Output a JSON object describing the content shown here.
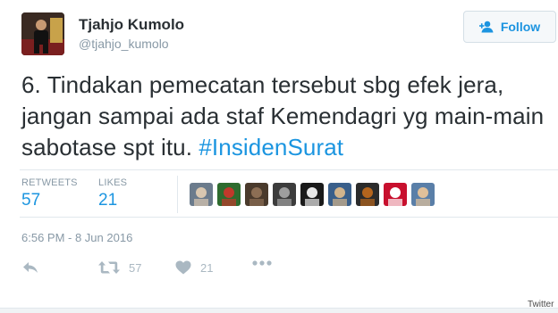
{
  "user": {
    "display_name": "Tjahjo Kumolo",
    "handle": "@tjahjo_kumolo"
  },
  "follow_button": {
    "label": "Follow",
    "icon": "add-user-icon",
    "accent": "#1c94e0"
  },
  "tweet": {
    "text": "6. Tindakan pemecatan tersebut sbg efek jera, jangan sampai ada staf Kemendagri yg main-main sabotase spt itu. ",
    "hashtag": "#InsidenSurat",
    "link_color": "#1b95e0"
  },
  "stats": {
    "retweets_label": "RETWEETS",
    "retweets_count": "57",
    "likes_label": "LIKES",
    "likes_count": "21"
  },
  "likers": [
    {
      "name": "liker-avatar-1",
      "colors": [
        "#6b7b8c",
        "#d9c7b0"
      ]
    },
    {
      "name": "liker-avatar-2",
      "colors": [
        "#2e6b2e",
        "#c0392b"
      ]
    },
    {
      "name": "liker-avatar-3",
      "colors": [
        "#4a3a2c",
        "#8c6e54"
      ]
    },
    {
      "name": "liker-avatar-4",
      "colors": [
        "#3c3c3c",
        "#9e9e9e"
      ]
    },
    {
      "name": "liker-avatar-5",
      "colors": [
        "#1a1a1a",
        "#e8e8e8"
      ]
    },
    {
      "name": "liker-avatar-6",
      "colors": [
        "#3a5f8a",
        "#d2b48c"
      ]
    },
    {
      "name": "liker-avatar-7",
      "colors": [
        "#2b2b2b",
        "#b5651d"
      ]
    },
    {
      "name": "liker-avatar-8",
      "colors": [
        "#c8102e",
        "#ffffff"
      ]
    },
    {
      "name": "liker-avatar-9",
      "colors": [
        "#5a7fa8",
        "#e0c09a"
      ]
    }
  ],
  "timestamp": "6:56 PM - 8 Jun 2016",
  "actions": {
    "retweet_count": "57",
    "like_count": "21"
  },
  "watermark": "Twitter"
}
